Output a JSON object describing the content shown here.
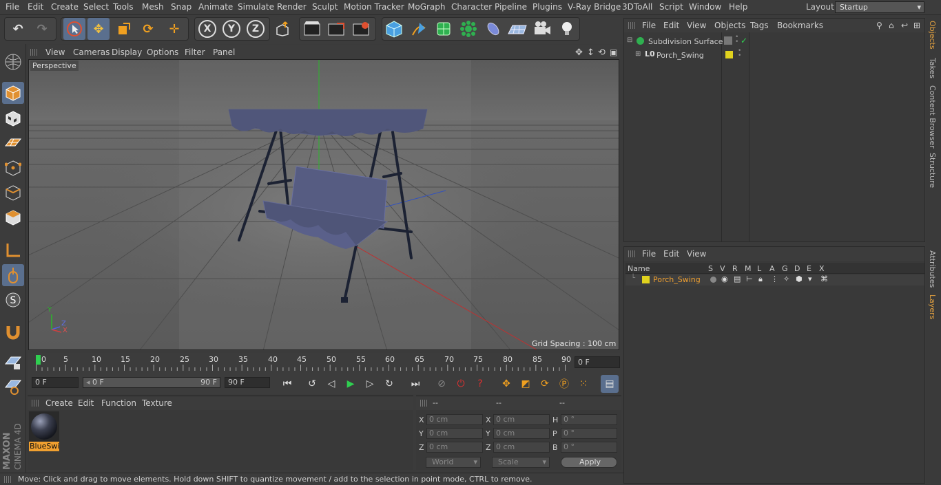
{
  "menubar": {
    "items": [
      "File",
      "Edit",
      "Create",
      "Select",
      "Tools",
      "Mesh",
      "Snap",
      "Animate",
      "Simulate",
      "Render",
      "Sculpt",
      "Motion Tracker",
      "MoGraph",
      "Character",
      "Pipeline",
      "Plugins",
      "V-Ray Bridge",
      "3DToAll",
      "Script",
      "Window",
      "Help"
    ],
    "layout_label": "Layout:",
    "layout_value": "Startup"
  },
  "viewport": {
    "menu": [
      "View",
      "Cameras",
      "Display",
      "Options",
      "Filter",
      "Panel"
    ],
    "label": "Perspective",
    "grid_spacing": "Grid Spacing : 100 cm",
    "axis_x": "X",
    "axis_y": "Y",
    "axis_z": "Z"
  },
  "timeline": {
    "ticks": [
      "0",
      "5",
      "10",
      "15",
      "20",
      "25",
      "30",
      "35",
      "40",
      "45",
      "50",
      "55",
      "60",
      "65",
      "70",
      "75",
      "80",
      "85",
      "90"
    ],
    "current_frame": "0 F"
  },
  "transport": {
    "start": "0 F",
    "range_start": "0 F",
    "range_end": "90 F",
    "end": "90 F"
  },
  "material_panel": {
    "menu": [
      "Create",
      "Edit",
      "Function",
      "Texture"
    ],
    "material_name": "BlueSwi"
  },
  "coord_panel": {
    "headers": [
      "--",
      "--",
      "--"
    ],
    "rows": [
      {
        "l1": "X",
        "v1": "0 cm",
        "l2": "X",
        "v2": "0 cm",
        "l3": "H",
        "v3": "0 °"
      },
      {
        "l1": "Y",
        "v1": "0 cm",
        "l2": "Y",
        "v2": "0 cm",
        "l3": "P",
        "v3": "0 °"
      },
      {
        "l1": "Z",
        "v1": "0 cm",
        "l2": "Z",
        "v2": "0 cm",
        "l3": "B",
        "v3": "0 °"
      }
    ],
    "world": "World",
    "scale": "Scale",
    "apply": "Apply"
  },
  "object_panel": {
    "menu": [
      "File",
      "Edit",
      "View",
      "Objects",
      "Tags",
      "Bookmarks"
    ],
    "items": [
      "Subdivision Surface",
      "Porch_Swing"
    ]
  },
  "layer_panel": {
    "menu": [
      "File",
      "Edit",
      "View"
    ],
    "columns": [
      "Name",
      "S",
      "V",
      "R",
      "M",
      "L",
      "A",
      "G",
      "D",
      "E",
      "X"
    ],
    "layer_name": "Porch_Swing"
  },
  "right_tabs": [
    "Objects",
    "Takes",
    "Content Browser",
    "Structure",
    "Attributes",
    "Layers"
  ],
  "brand": {
    "maxon": "MAXON",
    "cinema": "CINEMA 4D"
  },
  "status": "Move: Click and drag to move elements. Hold down SHIFT to quantize movement / add to the selection in point mode, CTRL to remove.",
  "colors": {
    "accent": "#5a6f8e",
    "layer_yellow": "#e0d21e",
    "highlight_text": "#f0a030"
  }
}
